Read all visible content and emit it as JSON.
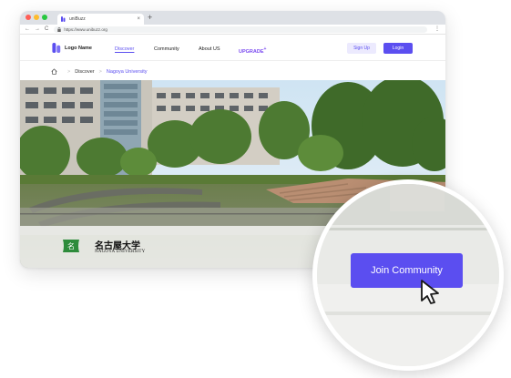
{
  "browser": {
    "tab_title": "uniBuzz",
    "tab_close": "×",
    "new_tab": "+",
    "url": "https://www.unibuzz.org",
    "nav": {
      "back": "←",
      "forward": "→",
      "reload": "C"
    },
    "lock": "🔒",
    "menu": "⋮"
  },
  "site": {
    "logo_text": "Logo Name",
    "nav": {
      "discover": "Discover",
      "community": "Community",
      "about": "About US",
      "upgrade": "UPGRADE",
      "upgrade_mark": "+"
    },
    "signup": "Sign Up",
    "login": "Login",
    "brand_color": "#5b4ef0"
  },
  "breadcrumb": {
    "items": [
      "Discover",
      "Nagoya University"
    ],
    "separator": ">"
  },
  "hero": {
    "university_name_jp": "名古屋大学",
    "university_name_en": "NAGOYA UNIVERSITY"
  },
  "callout": {
    "join_label": "Join Community"
  }
}
